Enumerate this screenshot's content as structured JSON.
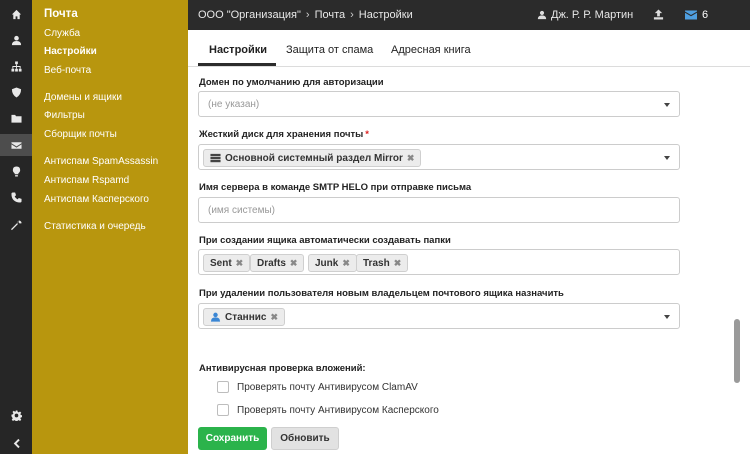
{
  "breadcrumb": {
    "org": "ООО \"Организация\"",
    "section": "Почта",
    "page": "Настройки",
    "separator": "›"
  },
  "user": {
    "name": "Дж. Р. Р. Мартин"
  },
  "mail": {
    "count": "6"
  },
  "sidebar": {
    "title": "Почта",
    "items": [
      {
        "label": "Служба"
      },
      {
        "label": "Настройки"
      },
      {
        "label": "Веб-почта"
      },
      {
        "label": "Домены и ящики"
      },
      {
        "label": "Фильтры"
      },
      {
        "label": "Сборщик почты"
      },
      {
        "label": "Антиспам SpamAssassin"
      },
      {
        "label": "Антиспам Rspamd"
      },
      {
        "label": "Антиспам Касперского"
      },
      {
        "label": "Статистика и очередь"
      }
    ]
  },
  "rail": {
    "icons": [
      "home-icon",
      "user-icon",
      "sitemap-icon",
      "shield-icon",
      "folder-icon",
      "envelope-icon",
      "lightbulb-icon",
      "phone-icon",
      "wrench-icon",
      "gear-icon",
      "chevron-left-icon"
    ]
  },
  "tabs": [
    {
      "label": "Настройки"
    },
    {
      "label": "Защита от спама"
    },
    {
      "label": "Адресная книга"
    }
  ],
  "form": {
    "default_domain": {
      "label": "Домен по умолчанию для авторизации",
      "placeholder": "(не указан)"
    },
    "disk": {
      "label": "Жесткий диск для хранения почты",
      "required": "*",
      "value": "Основной системный раздел Mirror",
      "remove": "✖"
    },
    "helo": {
      "label": "Имя сервера в команде SMTP HELO при отправке письма",
      "placeholder": "(имя системы)"
    },
    "folders": {
      "label": "При создании ящика автоматически создавать папки",
      "tags": [
        "Sent",
        "Drafts",
        "Junk",
        "Trash"
      ],
      "remove": "✖"
    },
    "owner": {
      "label": "При удалении пользователя новым владельцем почтового ящика назначить",
      "value": "Станнис",
      "remove": "✖"
    },
    "antivirus": {
      "title": "Антивирусная проверка вложений:",
      "clamav": "Проверять почту Антивирусом ClamAV",
      "kaspersky": "Проверять почту Антивирусом Касперского"
    }
  },
  "buttons": {
    "save": "Сохранить",
    "refresh": "Обновить"
  },
  "colors": {
    "sidebar": "#b8960e",
    "rail": "#262626",
    "topbar": "#2b2b2b",
    "save": "#2bb34b",
    "mail_icon": "#4f9fe0"
  }
}
